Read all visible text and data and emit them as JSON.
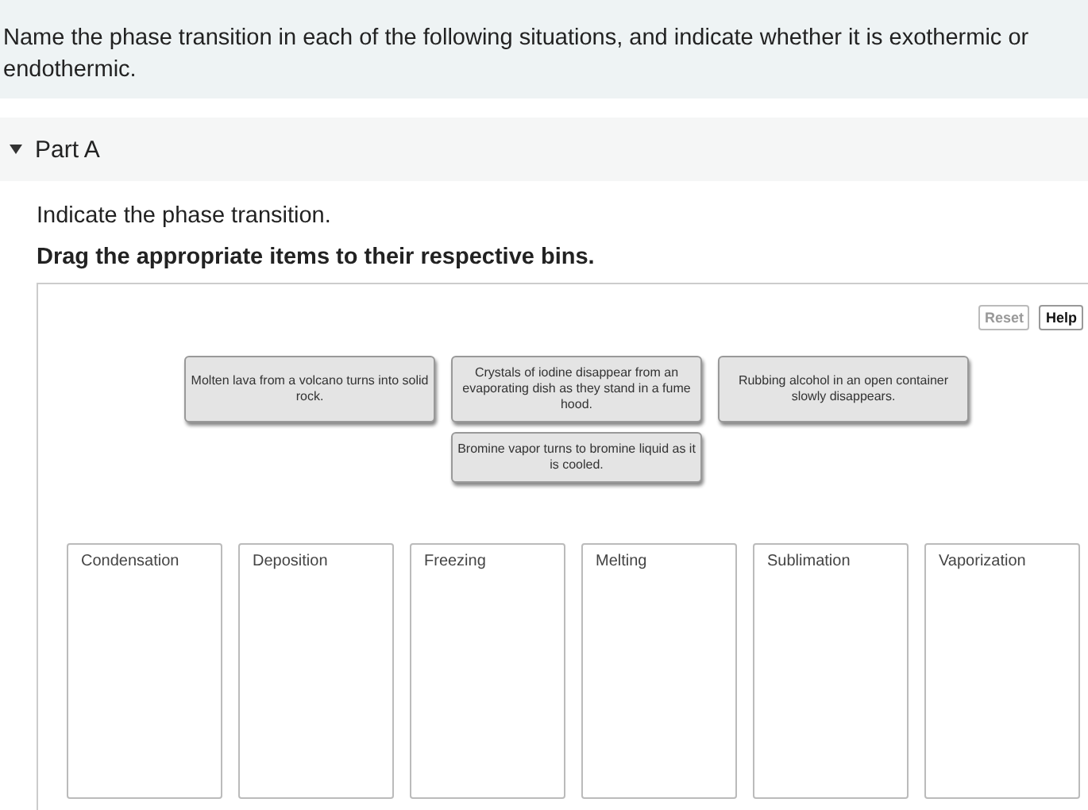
{
  "instructions": "Name the phase transition in each of the following situations, and indicate whether it is exothermic or endothermic.",
  "part": {
    "title": "Part A",
    "expanded": true
  },
  "prompt": "Indicate the phase transition.",
  "task": "Drag the appropriate items to their respective bins.",
  "buttons": [
    {
      "label": "Reset",
      "disabled": true
    },
    {
      "label": "Help",
      "disabled": false
    }
  ],
  "items": [
    "Molten lava from a volcano turns into solid rock.",
    "Crystals of iodine disappear from an evaporating dish as they stand in a fume hood.",
    "Rubbing alcohol in an open container slowly disappears.",
    "Bromine vapor turns to bromine liquid as it is cooled."
  ],
  "bins": [
    "Condensation",
    "Deposition",
    "Freezing",
    "Melting",
    "Sublimation",
    "Vaporization"
  ]
}
